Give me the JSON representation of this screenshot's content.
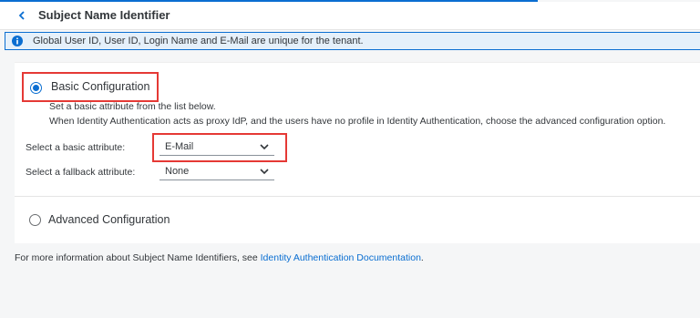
{
  "header": {
    "title": "Subject Name Identifier"
  },
  "info_strip": {
    "text": "Global User ID, User ID, Login Name and E-Mail are unique for the tenant."
  },
  "basic": {
    "label": "Basic Configuration",
    "selected": true,
    "description_line1": "Set a basic attribute from the list below.",
    "description_line2": "When Identity Authentication acts as proxy IdP, and the users have no profile in Identity Authentication, choose the advanced configuration option.",
    "attribute_label": "Select a basic attribute:",
    "attribute_value": "E-Mail",
    "fallback_label": "Select a fallback attribute:",
    "fallback_value": "None"
  },
  "advanced": {
    "label": "Advanced Configuration",
    "selected": false
  },
  "footer": {
    "text": "For more information about Subject Name Identifiers, see ",
    "link_text": "Identity Authentication Documentation",
    "suffix": "."
  },
  "colors": {
    "accent": "#0a6ed1",
    "highlight": "#e53935"
  }
}
